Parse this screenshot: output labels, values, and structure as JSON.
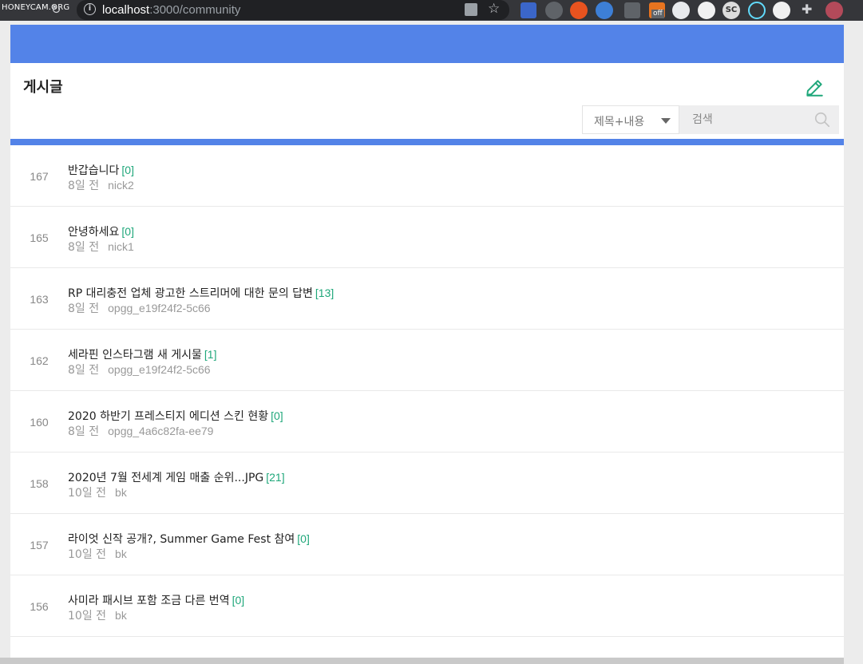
{
  "browser": {
    "watermark": "HONEYCAM.ORG",
    "url_host": "localhost",
    "url_path": ":3000/community"
  },
  "extensions": {
    "off_label": "off",
    "sc_label": "SC"
  },
  "page": {
    "title": "게시글",
    "search": {
      "filter_selected": "제목+내용",
      "placeholder": "검색"
    },
    "accent_color": "#5383e8",
    "comment_color": "#1fa77a"
  },
  "posts": [
    {
      "id": "167",
      "title": "반갑습니다",
      "comments": "[0]",
      "time": "8일 전",
      "author": "nick2"
    },
    {
      "id": "165",
      "title": "안녕하세요",
      "comments": "[0]",
      "time": "8일 전",
      "author": "nick1"
    },
    {
      "id": "163",
      "title": "RP 대리충전 업체 광고한 스트리머에 대한 문의 답변",
      "comments": "[13]",
      "time": "8일 전",
      "author": "opgg_e19f24f2-5c66"
    },
    {
      "id": "162",
      "title": "세라핀 인스타그램 새 게시물",
      "comments": "[1]",
      "time": "8일 전",
      "author": "opgg_e19f24f2-5c66"
    },
    {
      "id": "160",
      "title": "2020 하반기 프레스티지 에디션 스킨 현황",
      "comments": "[0]",
      "time": "8일 전",
      "author": "opgg_4a6c82fa-ee79"
    },
    {
      "id": "158",
      "title": "2020년 7월 전세계 게임 매출 순위...JPG",
      "comments": "[21]",
      "time": "10일 전",
      "author": "bk"
    },
    {
      "id": "157",
      "title": "라이엇 신작 공개?, Summer Game Fest 참여",
      "comments": "[0]",
      "time": "10일 전",
      "author": "bk"
    },
    {
      "id": "156",
      "title": "사미라 패시브 포함 조금 다른 번역",
      "comments": "[0]",
      "time": "10일 전",
      "author": "bk"
    }
  ]
}
